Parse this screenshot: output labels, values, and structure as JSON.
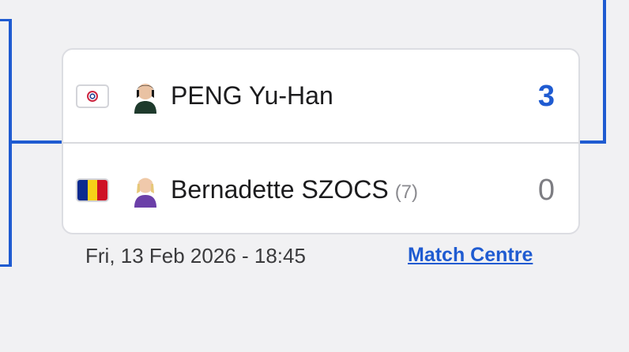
{
  "match": {
    "player1": {
      "name": "PENG Yu-Han",
      "seed": "",
      "score": "3",
      "flag_icon": "chinese-taipei-olympic-flag-icon"
    },
    "player2": {
      "name": "Bernadette SZOCS",
      "seed": "(7)",
      "score": "0",
      "flag_icon": "romania-flag-icon"
    },
    "datetime": "Fri, 13 Feb 2026 - 18:45",
    "match_centre_label": "Match Centre"
  },
  "colors": {
    "accent": "#1f5bd1",
    "card_background": "#ffffff",
    "page_background": "#f1f1f3",
    "romania_flag": [
      "#0b2a8f",
      "#f7d118",
      "#ce1126"
    ]
  }
}
